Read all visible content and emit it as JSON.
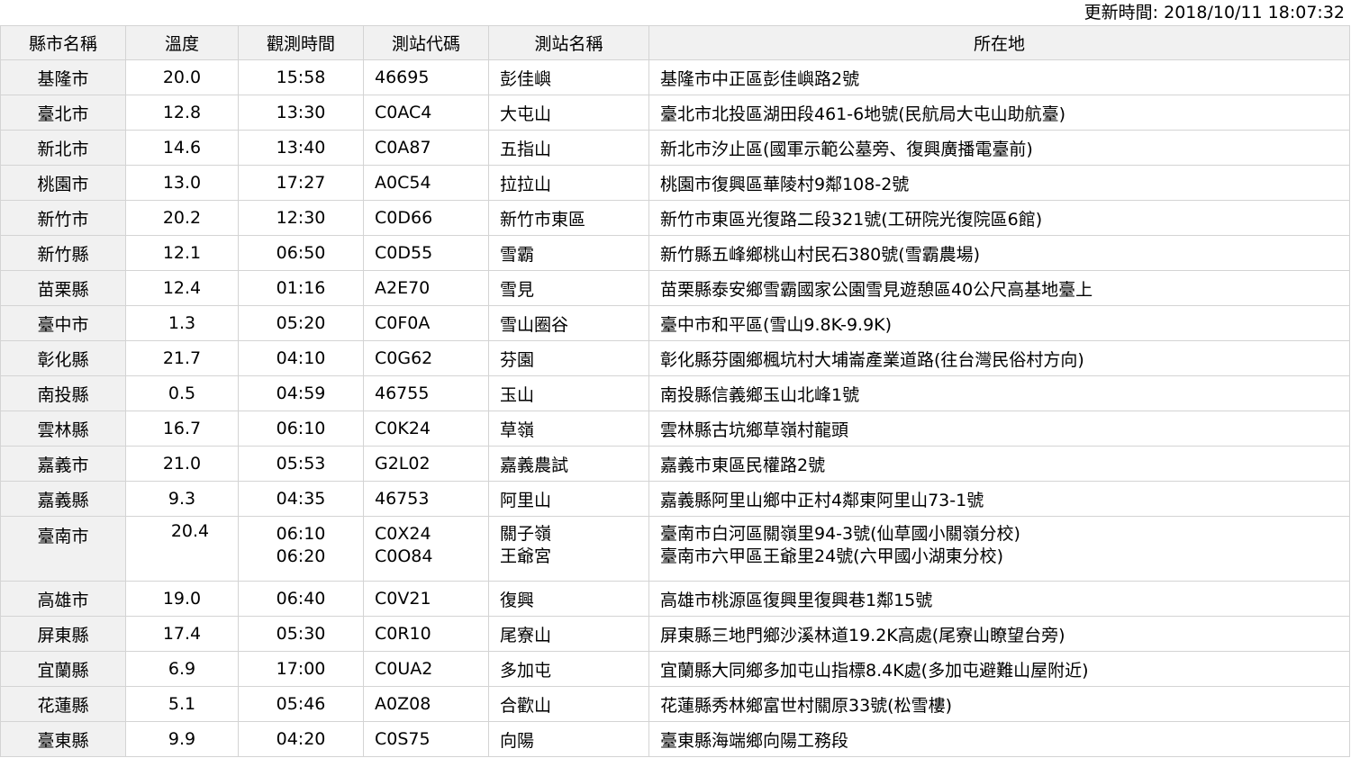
{
  "update_time": "更新時間: 2018/10/11 18:07:32",
  "headers": [
    "縣市名稱",
    "溫度",
    "觀測時間",
    "測站代碼",
    "測站名稱",
    "所在地"
  ],
  "rows": [
    {
      "county": "基隆市",
      "temp": "20.0",
      "time": "15:58",
      "code": "46695",
      "name": "彭佳嶼",
      "addr": "基隆市中正區彭佳嶼路2號"
    },
    {
      "county": "臺北市",
      "temp": "12.8",
      "time": "13:30",
      "code": "C0AC4",
      "name": "大屯山",
      "addr": "臺北市北投區湖田段461-6地號(民航局大屯山助航臺)"
    },
    {
      "county": "新北市",
      "temp": "14.6",
      "time": "13:40",
      "code": "C0A87",
      "name": "五指山",
      "addr": "新北市汐止區(國軍示範公墓旁、復興廣播電臺前)"
    },
    {
      "county": "桃園市",
      "temp": "13.0",
      "time": "17:27",
      "code": "A0C54",
      "name": "拉拉山",
      "addr": "桃園市復興區華陵村9鄰108-2號"
    },
    {
      "county": "新竹市",
      "temp": "20.2",
      "time": "12:30",
      "code": "C0D66",
      "name": "新竹市東區",
      "addr": "新竹市東區光復路二段321號(工研院光復院區6館)"
    },
    {
      "county": "新竹縣",
      "temp": "12.1",
      "time": "06:50",
      "code": "C0D55",
      "name": "雪霸",
      "addr": "新竹縣五峰鄉桃山村民石380號(雪霸農場)"
    },
    {
      "county": "苗栗縣",
      "temp": "12.4",
      "time": "01:16",
      "code": "A2E70",
      "name": "雪見",
      "addr": "苗栗縣泰安鄉雪霸國家公園雪見遊憩區40公尺高基地臺上"
    },
    {
      "county": "臺中市",
      "temp": "1.3",
      "time": "05:20",
      "code": "C0F0A",
      "name": "雪山圈谷",
      "addr": "臺中市和平區(雪山9.8K-9.9K)"
    },
    {
      "county": "彰化縣",
      "temp": "21.7",
      "time": "04:10",
      "code": "C0G62",
      "name": "芬園",
      "addr": "彰化縣芬園鄉楓坑村大埔崙產業道路(往台灣民俗村方向)"
    },
    {
      "county": "南投縣",
      "temp": "0.5",
      "time": "04:59",
      "code": "46755",
      "name": "玉山",
      "addr": "南投縣信義鄉玉山北峰1號"
    },
    {
      "county": "雲林縣",
      "temp": "16.7",
      "time": "06:10",
      "code": "C0K24",
      "name": "草嶺",
      "addr": "雲林縣古坑鄉草嶺村龍頭"
    },
    {
      "county": "嘉義市",
      "temp": "21.0",
      "time": "05:53",
      "code": "G2L02",
      "name": "嘉義農試",
      "addr": "嘉義市東區民權路2號"
    },
    {
      "county": "嘉義縣",
      "temp": "9.3",
      "time": "04:35",
      "code": "46753",
      "name": "阿里山",
      "addr": "嘉義縣阿里山鄉中正村4鄰東阿里山73-1號"
    },
    {
      "county": "臺南市",
      "temp": "20.4",
      "time": "06:10",
      "time2": "06:20",
      "code": "C0X24",
      "code2": "C0O84",
      "name": "關子嶺",
      "name2": "王爺宮",
      "addr": "臺南市白河區關嶺里94-3號(仙草國小關嶺分校)",
      "addr2": "臺南市六甲區王爺里24號(六甲國小湖東分校)"
    },
    {
      "county": "高雄市",
      "temp": "19.0",
      "time": "06:40",
      "code": "C0V21",
      "name": "復興",
      "addr": "高雄市桃源區復興里復興巷1鄰15號"
    },
    {
      "county": "屏東縣",
      "temp": "17.4",
      "time": "05:30",
      "code": "C0R10",
      "name": "尾寮山",
      "addr": "屏東縣三地門鄉沙溪林道19.2K高處(尾寮山瞭望台旁)"
    },
    {
      "county": "宜蘭縣",
      "temp": "6.9",
      "time": "17:00",
      "code": "C0UA2",
      "name": "多加屯",
      "addr": "宜蘭縣大同鄉多加屯山指標8.4K處(多加屯避難山屋附近)"
    },
    {
      "county": "花蓮縣",
      "temp": "5.1",
      "time": "05:46",
      "code": "A0Z08",
      "name": "合歡山",
      "addr": "花蓮縣秀林鄉富世村關原33號(松雪樓)"
    },
    {
      "county": "臺東縣",
      "temp": "9.9",
      "time": "04:20",
      "code": "C0S75",
      "name": "向陽",
      "addr": "臺東縣海端鄉向陽工務段"
    }
  ]
}
